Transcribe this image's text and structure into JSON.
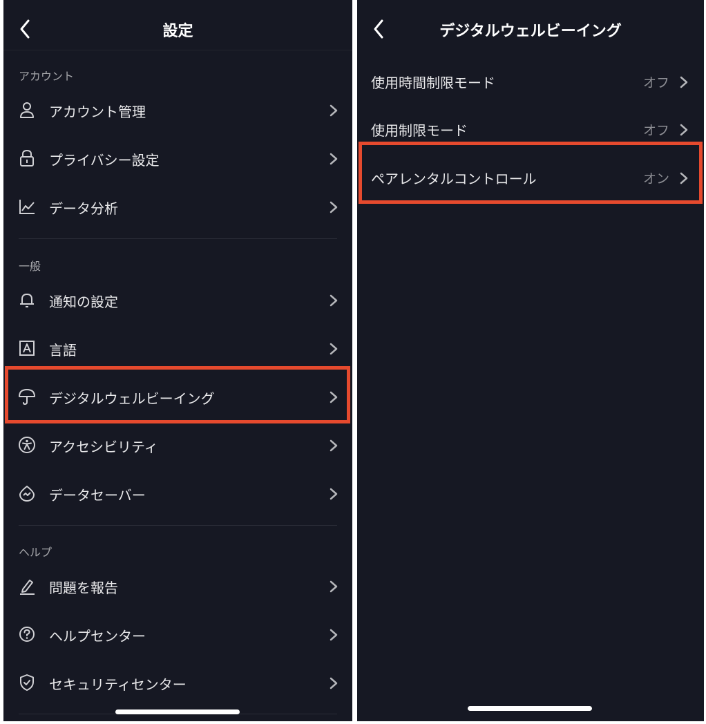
{
  "left": {
    "title": "設定",
    "sections": [
      {
        "title": "アカウント",
        "items": [
          {
            "label": "アカウント管理",
            "icon": "person-icon"
          },
          {
            "label": "プライバシー設定",
            "icon": "lock-icon"
          },
          {
            "label": "データ分析",
            "icon": "analytics-icon"
          }
        ]
      },
      {
        "title": "一般",
        "items": [
          {
            "label": "通知の設定",
            "icon": "bell-icon"
          },
          {
            "label": "言語",
            "icon": "language-icon"
          },
          {
            "label": "デジタルウェルビーイング",
            "icon": "umbrella-icon"
          },
          {
            "label": "アクセシビリティ",
            "icon": "accessibility-icon"
          },
          {
            "label": "データセーバー",
            "icon": "data-saver-icon"
          }
        ]
      },
      {
        "title": "ヘルプ",
        "items": [
          {
            "label": "問題を報告",
            "icon": "pencil-icon"
          },
          {
            "label": "ヘルプセンター",
            "icon": "help-icon"
          },
          {
            "label": "セキュリティセンター",
            "icon": "shield-icon"
          }
        ]
      }
    ]
  },
  "right": {
    "title": "デジタルウェルビーイング",
    "items": [
      {
        "label": "使用時間制限モード",
        "value": "オフ"
      },
      {
        "label": "使用制限モード",
        "value": "オフ"
      },
      {
        "label": "ペアレンタルコントロール",
        "value": "オン"
      }
    ]
  },
  "colors": {
    "background": "#161823",
    "highlight": "#e64a2e",
    "text": "#e8e8ea",
    "secondary_text": "#a6a7ab"
  }
}
